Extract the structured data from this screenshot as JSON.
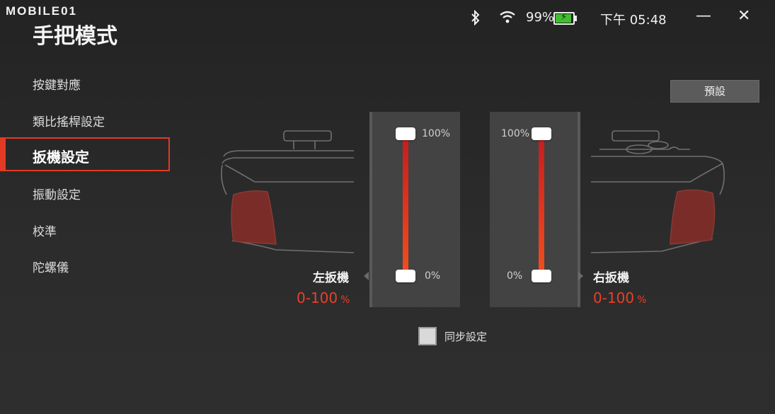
{
  "brand": {
    "logo": "MOBILE01"
  },
  "page": {
    "title": "手把模式"
  },
  "status": {
    "battery": "99%",
    "battery_level": 0.99,
    "time": "下午 05:48",
    "bluetooth_icon": "bluetooth-icon",
    "wifi_icon": "wifi-icon"
  },
  "window": {
    "minimize": "—",
    "close": "✕"
  },
  "sidebar": {
    "items": [
      {
        "label": "按鍵對應"
      },
      {
        "label": "類比搖桿設定"
      },
      {
        "label": "扳機設定"
      },
      {
        "label": "振動設定"
      },
      {
        "label": "校準"
      },
      {
        "label": "陀螺儀"
      }
    ],
    "active_index": 2
  },
  "main": {
    "preset_label": "預設",
    "left_trigger": {
      "label": "左扳機",
      "range": "0-100",
      "unit": "%",
      "top_pct": "100%",
      "bottom_pct": "0%",
      "min": 0,
      "max": 100
    },
    "right_trigger": {
      "label": "右扳機",
      "range": "0-100",
      "unit": "%",
      "top_pct": "100%",
      "bottom_pct": "0%",
      "min": 0,
      "max": 100
    },
    "sync_label": "同步設定",
    "sync_checked": false
  },
  "colors": {
    "accent": "#e23a24",
    "track": "#e33a1f",
    "panel": "#434343",
    "grip": "#7a2c28"
  }
}
